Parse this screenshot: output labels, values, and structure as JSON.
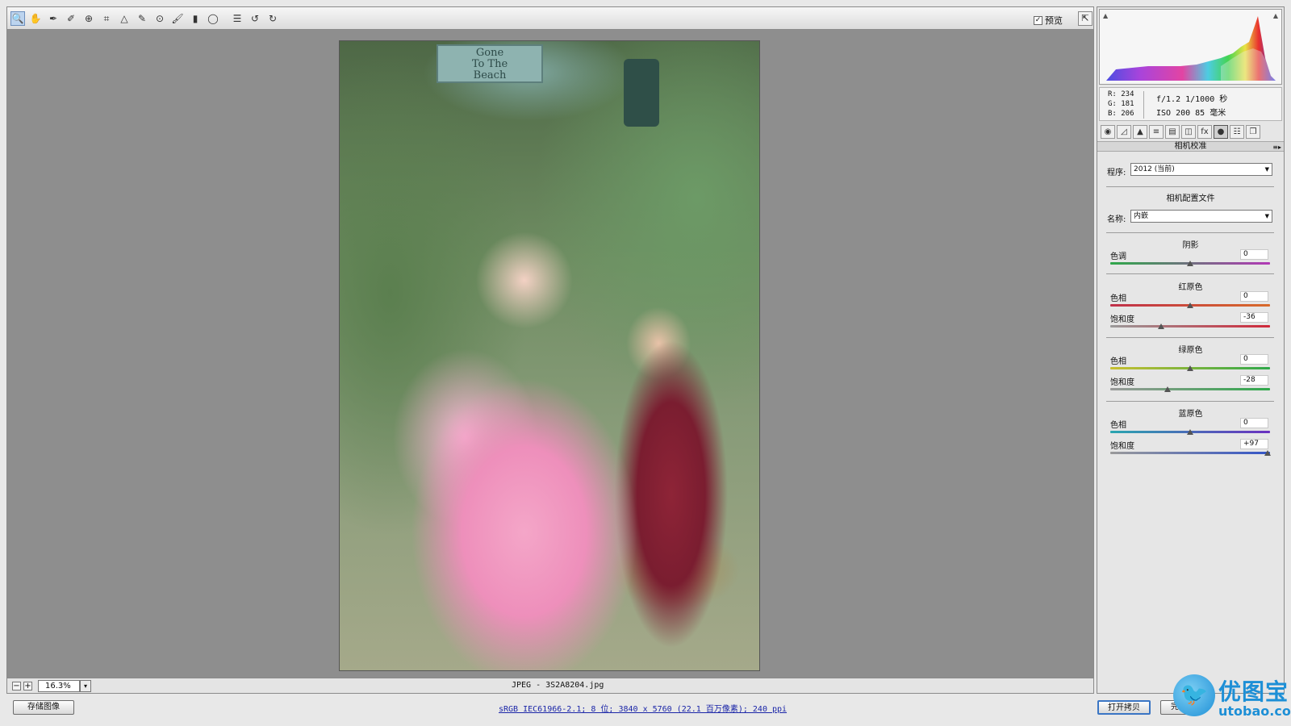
{
  "toolbar": {
    "tools": [
      {
        "name": "zoom-tool-icon",
        "glyph": "🔍",
        "active": true
      },
      {
        "name": "hand-tool-icon",
        "glyph": "✋"
      },
      {
        "name": "white-balance-tool-icon",
        "glyph": "✒"
      },
      {
        "name": "color-sampler-tool-icon",
        "glyph": "✐"
      },
      {
        "name": "targeted-adjustment-tool-icon",
        "glyph": "⊕"
      },
      {
        "name": "crop-tool-icon",
        "glyph": "⌗"
      },
      {
        "name": "straighten-tool-icon",
        "glyph": "△"
      },
      {
        "name": "spot-removal-tool-icon",
        "glyph": "✎"
      },
      {
        "name": "red-eye-removal-tool-icon",
        "glyph": "⊙"
      },
      {
        "name": "adjustment-brush-icon",
        "glyph": "🖌"
      },
      {
        "name": "graduated-filter-icon",
        "glyph": "▮"
      },
      {
        "name": "radial-filter-icon",
        "glyph": "◯"
      },
      {
        "name": "preferences-icon",
        "glyph": "☰"
      },
      {
        "name": "rotate-left-icon",
        "glyph": "↺"
      },
      {
        "name": "rotate-right-icon",
        "glyph": "↻"
      }
    ],
    "preview_label": "预览",
    "preview_checked": "✓",
    "fullscreen_glyph": "⇱"
  },
  "status": {
    "zoom_value": "16.3%",
    "zoom_out_glyph": "−",
    "zoom_in_glyph": "+",
    "dropdown_glyph": "▾",
    "file_label": "JPEG -  3S2A8204.jpg"
  },
  "bottom": {
    "save_label": "存储图像",
    "workflow_link": "sRGB IEC61966-2.1; 8 位; 3840 x 5760 (22.1 百万像素); 240 ppi",
    "open_copy_label": "打开拷贝",
    "done_label": "完成"
  },
  "photo": {
    "sign_line1": "Gone",
    "sign_line2": "To The",
    "sign_line3": "Beach"
  },
  "histogram_labels": {
    "shadow_clip_glyph": "▲",
    "highlight_clip_glyph": "▲"
  },
  "readout": {
    "r": "R:  234",
    "g": "G:  181",
    "b": "B:  206",
    "exif_line1": "f/1.2  1/1000 秒",
    "exif_line2": "ISO 200  85 毫米"
  },
  "tabs": [
    {
      "name": "tab-basic",
      "glyph": "◉"
    },
    {
      "name": "tab-tone-curve",
      "glyph": "◿"
    },
    {
      "name": "tab-detail",
      "glyph": "▲"
    },
    {
      "name": "tab-hsl",
      "glyph": "≡"
    },
    {
      "name": "tab-split-toning",
      "glyph": "▤"
    },
    {
      "name": "tab-lens-corrections",
      "glyph": "◫"
    },
    {
      "name": "tab-effects",
      "glyph": "fx"
    },
    {
      "name": "tab-camera-calibration",
      "glyph": "●",
      "active": true
    },
    {
      "name": "tab-presets",
      "glyph": "☷"
    },
    {
      "name": "tab-snapshots",
      "glyph": "❐"
    }
  ],
  "panel": {
    "section_title": "相机校准",
    "menu_glyph": "≡▸",
    "process_label": "程序:",
    "process_value": "2012 (当前)",
    "profile_title": "相机配置文件",
    "name_label": "名称:",
    "name_value": "内嵌",
    "select_arrow": "▼"
  },
  "calibration": {
    "shadows": {
      "title": "阴影",
      "tint_label": "色调",
      "tint_value": "0",
      "tint_level": 0
    },
    "red": {
      "title": "红原色",
      "hue_label": "色相",
      "hue_value": "0",
      "hue_level": 0,
      "sat_label": "饱和度",
      "sat_value": "-36",
      "sat_level": -36
    },
    "green": {
      "title": "绿原色",
      "hue_label": "色相",
      "hue_value": "0",
      "hue_level": 0,
      "sat_label": "饱和度",
      "sat_value": "-28",
      "sat_level": -28
    },
    "blue": {
      "title": "蓝原色",
      "hue_label": "色相",
      "hue_value": "0",
      "hue_level": 0,
      "sat_label": "饱和度",
      "sat_value": "+97",
      "sat_level": 97
    }
  },
  "slider_colors": {
    "tint": [
      "#2fa84a",
      "#b238b6"
    ],
    "red_hue": [
      "#c0304a",
      "#d86a2a"
    ],
    "red_sat": [
      "#9a9a9a",
      "#d0283a"
    ],
    "green_hue": [
      "#c8c030",
      "#2fa84a"
    ],
    "green_sat": [
      "#9a9a9a",
      "#2fa84a"
    ],
    "blue_hue": [
      "#2aa6b0",
      "#6a30c0"
    ],
    "blue_sat": [
      "#9a9a9a",
      "#3355c8"
    ]
  },
  "watermark": {
    "logo_glyph": "🐦",
    "cn": "优图宝",
    "en": "utobao.com"
  }
}
